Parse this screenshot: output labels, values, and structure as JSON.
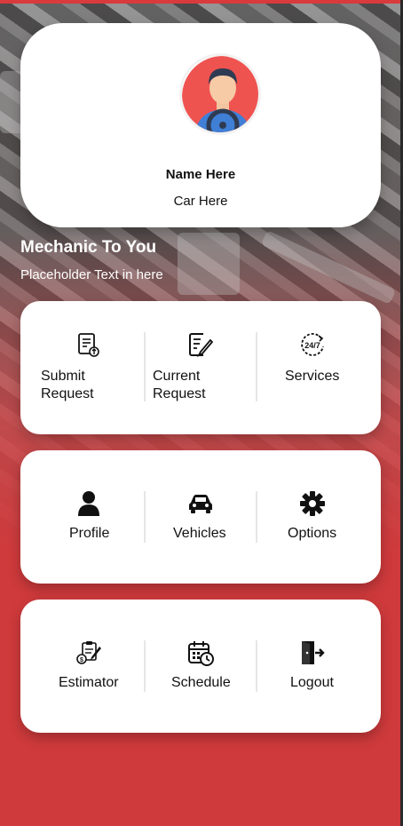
{
  "profile": {
    "name": "Name Here",
    "car": "Car Here"
  },
  "app": {
    "title": "Mechanic To You",
    "subtitle": "Placeholder Text in here"
  },
  "menu": {
    "row1": [
      {
        "label": "Submit Request",
        "line1": "Submit",
        "line2": "Request",
        "icon": "document-submit-icon"
      },
      {
        "label": "Current Request",
        "line1": "Current",
        "line2": "Request",
        "icon": "edit-document-icon"
      },
      {
        "label": "Services",
        "icon": "24-7-icon"
      }
    ],
    "row2": [
      {
        "label": "Profile",
        "icon": "user-icon"
      },
      {
        "label": "Vehicles",
        "icon": "car-icon"
      },
      {
        "label": "Options",
        "icon": "gear-icon"
      }
    ],
    "row3": [
      {
        "label": "Estimator",
        "icon": "estimator-icon"
      },
      {
        "label": "Schedule",
        "icon": "calendar-clock-icon"
      },
      {
        "label": "Logout",
        "icon": "logout-icon"
      }
    ]
  },
  "colors": {
    "accent": "#cf3a3c",
    "card": "#ffffff",
    "text": "#111111"
  }
}
